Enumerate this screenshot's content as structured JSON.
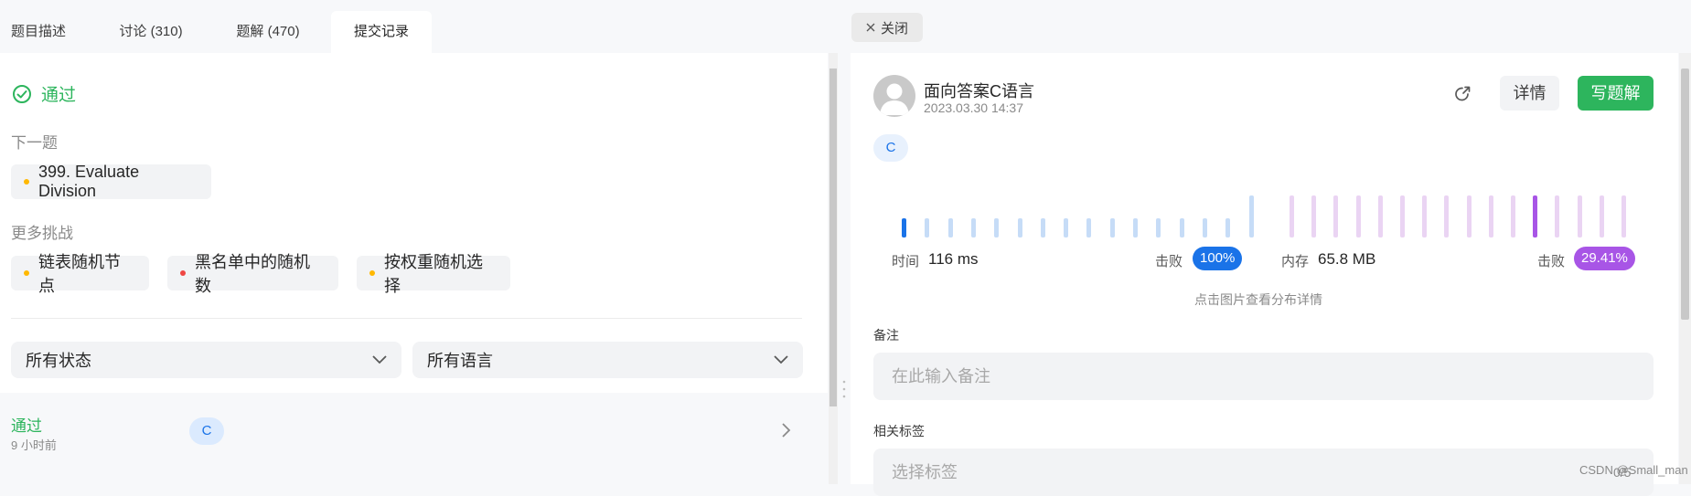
{
  "tabs": [
    {
      "label": "题目描述"
    },
    {
      "label": "讨论 (310)"
    },
    {
      "label": "题解 (470)"
    },
    {
      "label": "提交记录"
    }
  ],
  "left": {
    "status": "通过",
    "next_label": "下一题",
    "next_problem": "399. Evaluate Division",
    "more_label": "更多挑战",
    "challenges": [
      {
        "label": "链表随机节点",
        "color": "#ffb800"
      },
      {
        "label": "黑名单中的随机数",
        "color": "#ef4743"
      },
      {
        "label": "按权重随机选择",
        "color": "#ffb800"
      }
    ],
    "filters": {
      "status": "所有状态",
      "language": "所有语言"
    },
    "submission": {
      "status": "通过",
      "time": "9 小时前",
      "lang": "C"
    }
  },
  "right": {
    "close_label": "关闭",
    "author": "面向答案C语言",
    "date": "2023.03.30 14:37",
    "detail_label": "详情",
    "write_label": "写题解",
    "language_tag": "C",
    "runtime": {
      "label": "时间",
      "value": "116 ms",
      "beat_label": "击败",
      "beat": "100%",
      "color": "#1a73e8",
      "light": "#c6dcf7",
      "bar_levels": [
        0.45,
        0.45,
        0.45,
        0.45,
        0.45,
        0.45,
        0.45,
        0.45,
        0.45,
        0.45,
        0.45,
        0.45,
        0.45,
        0.45,
        0.45,
        1.0
      ],
      "highlight_index": 0
    },
    "memory": {
      "label": "内存",
      "value": "65.8 MB",
      "beat_label": "击败",
      "beat": "29.41%",
      "color": "#a855e6",
      "light": "#ead4f3",
      "bar_levels": [
        1,
        1,
        1,
        1,
        1,
        1,
        1,
        1,
        1,
        1,
        1,
        1,
        1,
        1,
        1,
        1
      ],
      "highlight_index": 11
    },
    "chart_hint": "点击图片查看分布详情",
    "note_label": "备注",
    "note_placeholder": "在此输入备注",
    "tags_label": "相关标签",
    "tags_placeholder": "选择标签",
    "tags_count": "0/5"
  },
  "watermark": "CSDN @Small_man"
}
